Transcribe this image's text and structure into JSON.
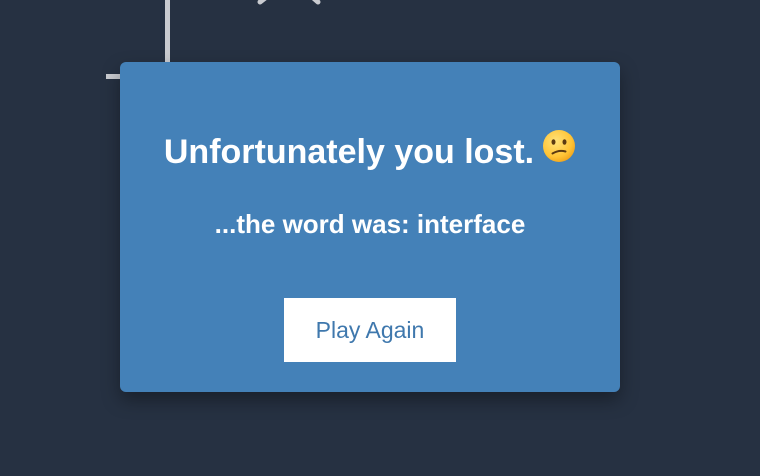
{
  "modal": {
    "title": "Unfortunately you lost.",
    "emoji_icon": "confused-face-icon",
    "subtitle_prefix": "...the word was: ",
    "word": "interface",
    "subtitle": "...the word was: interface",
    "button_label": "Play Again"
  },
  "colors": {
    "background": "#263142",
    "modal": "#4481b8",
    "button_text": "#3f78ad",
    "drawing": "#c9cbd0"
  }
}
